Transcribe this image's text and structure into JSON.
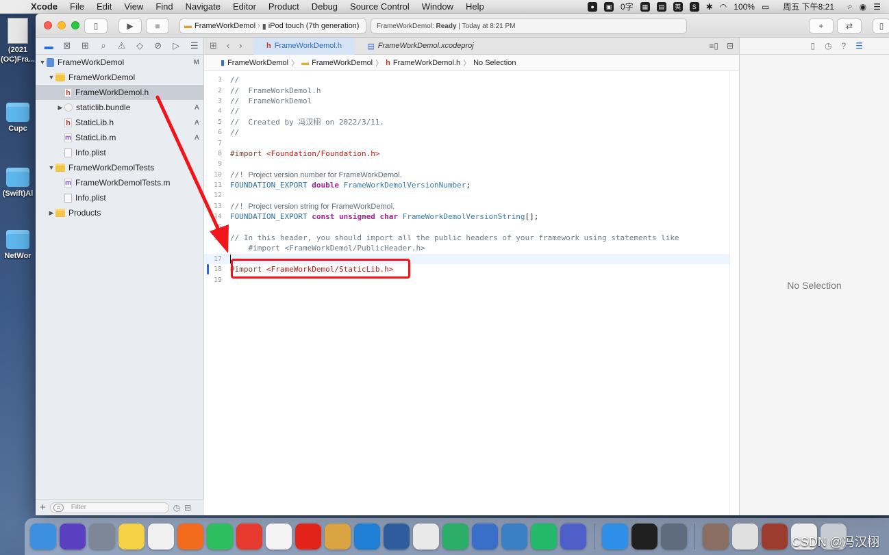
{
  "menubar": {
    "app": "Xcode",
    "items": [
      "File",
      "Edit",
      "View",
      "Find",
      "Navigate",
      "Editor",
      "Product",
      "Debug",
      "Source Control",
      "Window",
      "Help"
    ],
    "status_icons": [
      "0字",
      "英"
    ],
    "battery": "100%",
    "clock": "周五 下午8:21"
  },
  "desktop": {
    "items": [
      {
        "label": "(2021\n(OC)Fra..."
      },
      {
        "label": "Cupc"
      },
      {
        "label": "(Swift)Al"
      },
      {
        "label": "NetWor"
      }
    ]
  },
  "titlebar": {
    "scheme_target": "FrameWorkDemol",
    "scheme_device": "iPod touch (7th generation)",
    "status_project": "FrameWorkDemol:",
    "status_state": "Ready",
    "status_time": "Today at 8:21 PM"
  },
  "navigator": {
    "project": {
      "name": "FrameWorkDemol",
      "badge": "M"
    },
    "rows": [
      {
        "name": "FrameWorkDemol",
        "kind": "folder",
        "indent": 1
      },
      {
        "name": "FrameWorkDemol.h",
        "kind": "hfile",
        "indent": 2,
        "selected": true
      },
      {
        "name": "staticlib.bundle",
        "kind": "bundle",
        "indent": 2,
        "badge": "A",
        "disclosure": true
      },
      {
        "name": "StaticLib.h",
        "kind": "hfile",
        "indent": 2,
        "badge": "A"
      },
      {
        "name": "StaticLib.m",
        "kind": "mfile",
        "indent": 2,
        "badge": "A"
      },
      {
        "name": "Info.plist",
        "kind": "plist",
        "indent": 2
      },
      {
        "name": "FrameWorkDemolTests",
        "kind": "folder",
        "indent": 1
      },
      {
        "name": "FrameWorkDemolTests.m",
        "kind": "mfile",
        "indent": 2
      },
      {
        "name": "Info.plist",
        "kind": "plist",
        "indent": 2
      },
      {
        "name": "Products",
        "kind": "folder",
        "indent": 1,
        "disclosure": true
      }
    ],
    "filter_placeholder": "Filter"
  },
  "editor": {
    "tabs": [
      {
        "label": "FrameWorkDemol.h",
        "active": true
      },
      {
        "label": "FrameWorkDemol.xcodeproj",
        "active": false
      }
    ],
    "jumpbar": [
      "FrameWorkDemol",
      "FrameWorkDemol",
      "FrameWorkDemol.h",
      "No Selection"
    ],
    "lines": [
      {
        "n": "1",
        "parts": [
          {
            "t": "//",
            "c": "comment"
          }
        ]
      },
      {
        "n": "2",
        "parts": [
          {
            "t": "//  FrameWorkDemol.h",
            "c": "comment"
          }
        ]
      },
      {
        "n": "3",
        "parts": [
          {
            "t": "//  FrameWorkDemol",
            "c": "comment"
          }
        ]
      },
      {
        "n": "4",
        "parts": [
          {
            "t": "//",
            "c": "comment"
          }
        ]
      },
      {
        "n": "5",
        "parts": [
          {
            "t": "//  Created by 冯汉栩 on 2022/3/11.",
            "c": "comment"
          }
        ]
      },
      {
        "n": "6",
        "parts": [
          {
            "t": "//",
            "c": "comment"
          }
        ]
      },
      {
        "n": "7",
        "parts": []
      },
      {
        "n": "8",
        "parts": [
          {
            "t": "#import ",
            "c": "pre"
          },
          {
            "t": "<Foundation/Foundation.h>",
            "c": "str"
          }
        ]
      },
      {
        "n": "9",
        "parts": []
      },
      {
        "n": "10",
        "parts": [
          {
            "t": "//! ",
            "c": "comment"
          },
          {
            "t": "Project version number for FrameWorkDemol.",
            "c": "doc"
          }
        ]
      },
      {
        "n": "11",
        "parts": [
          {
            "t": "FOUNDATION_EXPORT ",
            "c": "macro"
          },
          {
            "t": "double ",
            "c": "kw"
          },
          {
            "t": "FrameWorkDemolVersionNumber",
            "c": "type"
          },
          {
            "t": ";",
            "c": "plain"
          }
        ]
      },
      {
        "n": "12",
        "parts": []
      },
      {
        "n": "13",
        "parts": [
          {
            "t": "//! ",
            "c": "comment"
          },
          {
            "t": "Project version string for FrameWorkDemol.",
            "c": "doc"
          }
        ]
      },
      {
        "n": "14",
        "parts": [
          {
            "t": "FOUNDATION_EXPORT ",
            "c": "macro"
          },
          {
            "t": "const unsigned char ",
            "c": "kw"
          },
          {
            "t": "FrameWorkDemolVersionString",
            "c": "type"
          },
          {
            "t": "[];",
            "c": "plain"
          }
        ]
      },
      {
        "n": "15",
        "parts": []
      },
      {
        "n": "16",
        "parts": [
          {
            "t": "// In this header, you should import all the public headers of your framework using statements like",
            "c": "comment"
          }
        ]
      },
      {
        "n": "",
        "parts": [
          {
            "t": "    #import <FrameWorkDemol/PublicHeader.h>",
            "c": "comment"
          }
        ]
      },
      {
        "n": "17",
        "parts": [],
        "current": true
      },
      {
        "n": "18",
        "parts": [
          {
            "t": "#import ",
            "c": "pre"
          },
          {
            "t": "<FrameWorkDemol/StaticLib.h>",
            "c": "str"
          }
        ],
        "changed": true
      },
      {
        "n": "19",
        "parts": []
      }
    ]
  },
  "inspector": {
    "empty_label": "No Selection"
  },
  "annotation": {
    "color": "#f0151b"
  },
  "dock": {
    "apps": [
      {
        "icon": "finder-icon",
        "color": "#3d8fe0"
      },
      {
        "icon": "siri-icon",
        "color": "#5a3fc0"
      },
      {
        "icon": "launchpad-icon",
        "color": "#7d8795"
      },
      {
        "icon": "notes-icon",
        "color": "#f5d245"
      },
      {
        "icon": "photos-app-icon",
        "color": "#f0f0f0"
      },
      {
        "icon": "pen-app-icon",
        "color": "#f26b1d"
      },
      {
        "icon": "evernote-icon",
        "color": "#2dbe60"
      },
      {
        "icon": "wps-icon",
        "color": "#e63a2e"
      },
      {
        "icon": "design-app-icon",
        "color": "#f3f3f3"
      },
      {
        "icon": "netease-music-icon",
        "color": "#e2231a"
      },
      {
        "icon": "palette-app-icon",
        "color": "#d9a441"
      },
      {
        "icon": "vscode-icon",
        "color": "#1f7fd4"
      },
      {
        "icon": "sourcetree-icon",
        "color": "#2f5c9c"
      },
      {
        "icon": "chrome-icon",
        "color": "#e9e9e9"
      },
      {
        "icon": "wechat-icon",
        "color": "#2aae67"
      },
      {
        "icon": "xcode-instruments-icon",
        "color": "#3a6fc9"
      },
      {
        "icon": "android-studio-icon",
        "color": "#3b7fc4"
      },
      {
        "icon": "media-player-icon",
        "color": "#23b86a"
      },
      {
        "icon": "video-app-icon",
        "color": "#4f5fc9"
      },
      {
        "icon": "xcode-icon",
        "color": "#2d8fe8"
      },
      {
        "icon": "terminal-icon",
        "color": "#202020"
      },
      {
        "icon": "quicktime-icon",
        "color": "#5f6c7d"
      },
      {
        "icon": "photo-thumb-icon",
        "color": "#8a6e64"
      },
      {
        "icon": "window-thumb-icon",
        "color": "#e0e0e0"
      },
      {
        "icon": "phone-thumb-icon",
        "color": "#9b3c2f"
      },
      {
        "icon": "doc-thumb-icon",
        "color": "#ececec"
      },
      {
        "icon": "trash-icon",
        "color": "#c7ccd3"
      }
    ]
  },
  "watermark": "CSDN @冯汉栩"
}
